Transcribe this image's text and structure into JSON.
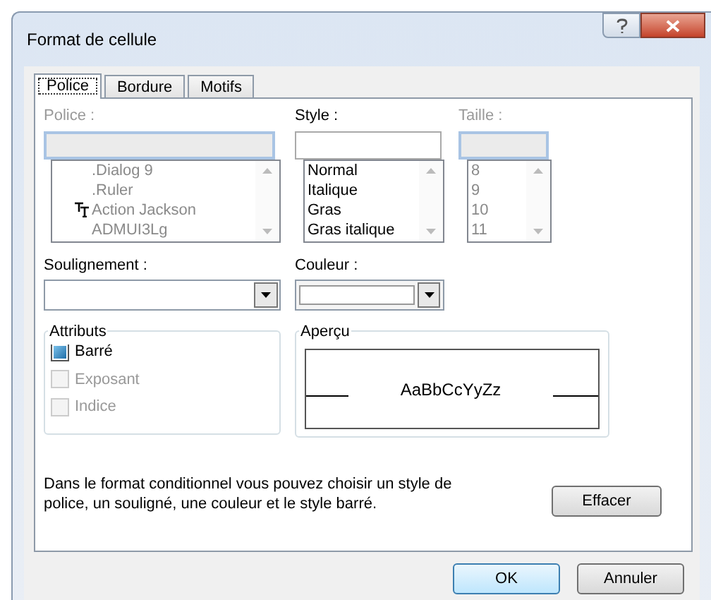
{
  "window": {
    "title": "Format de cellule"
  },
  "tabs": [
    {
      "label": "Police",
      "selected": true
    },
    {
      "label": "Bordure",
      "selected": false
    },
    {
      "label": "Motifs",
      "selected": false
    }
  ],
  "font": {
    "label": "Police :",
    "disabled": true,
    "items": [
      {
        "text": ".Dialog 9",
        "truetype": false
      },
      {
        "text": ".Ruler",
        "truetype": false
      },
      {
        "text": "Action Jackson",
        "truetype": true
      },
      {
        "text": "ADMUI3Lg",
        "truetype": false
      }
    ]
  },
  "style": {
    "label": "Style :",
    "disabled": false,
    "items": [
      {
        "text": "Normal"
      },
      {
        "text": "Italique"
      },
      {
        "text": "Gras"
      },
      {
        "text": "Gras italique"
      }
    ]
  },
  "size": {
    "label": "Taille :",
    "disabled": true,
    "items": [
      {
        "text": "8"
      },
      {
        "text": "9"
      },
      {
        "text": "10"
      },
      {
        "text": "11"
      }
    ]
  },
  "underline": {
    "label": "Soulignement :"
  },
  "color": {
    "label": "Couleur :"
  },
  "attributes": {
    "title": "Attributs",
    "items": [
      {
        "label": "Barré",
        "checked": true,
        "disabled": false
      },
      {
        "label": "Exposant",
        "checked": false,
        "disabled": true
      },
      {
        "label": "Indice",
        "checked": false,
        "disabled": true
      }
    ]
  },
  "preview": {
    "title": "Aperçu",
    "sample": "AaBbCcYyZz"
  },
  "help_text": "Dans le format conditionnel vous pouvez choisir un style de police, un souligné, une couleur et le style barré.",
  "clear_button": "Effacer",
  "buttons": [
    {
      "label": "OK",
      "default": true
    },
    {
      "label": "Annuler",
      "default": false
    }
  ]
}
